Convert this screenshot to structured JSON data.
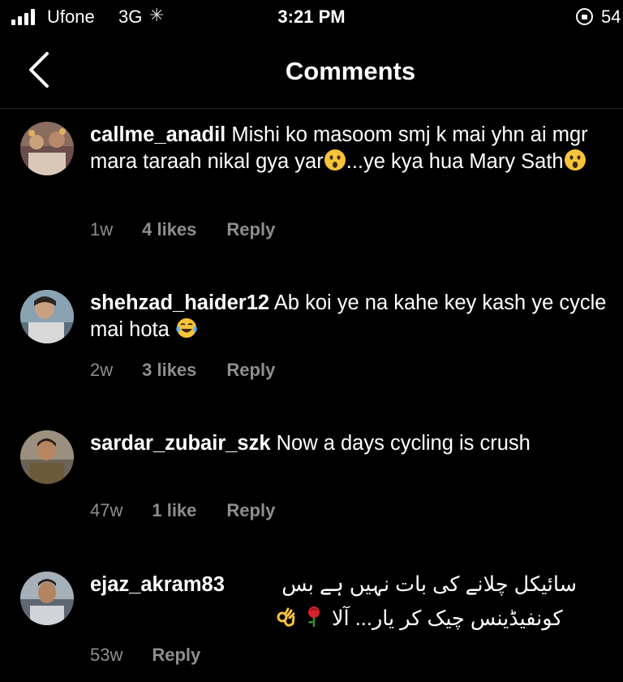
{
  "status_bar": {
    "carrier": "Ufone",
    "network": "3G",
    "time": "3:21 PM",
    "battery": "54"
  },
  "header": {
    "title": "Comments",
    "back_icon": "chevron-left-icon"
  },
  "comments": [
    {
      "username": "callme_anadil",
      "text_part1": "Mishi ko masoom smj k mai yhn ai mgr mara taraah nikal gya yar",
      "text_part2": "...ye kya hua Mary Sath",
      "time": "1w",
      "likes": "4 likes",
      "reply": "Reply"
    },
    {
      "username": "shehzad_haider12",
      "text": "Ab koi ye na kahe key kash ye cycle mai hota",
      "time": "2w",
      "likes": "3 likes",
      "reply": "Reply"
    },
    {
      "username": "sardar_zubair_szk",
      "text": "Now a days cycling is crush",
      "time": "47w",
      "likes": "1 like",
      "reply": "Reply"
    },
    {
      "username": "ejaz_akram83",
      "text_line1": "سائیکل چلانے کی بات نہیں ہے بس",
      "text_line2": "کونفیڈینس چیک کر یار... آلا",
      "time": "53w",
      "reply": "Reply"
    }
  ],
  "colors": {
    "background": "#000000",
    "text": "#ffffff",
    "secondary_text": "#8e8e8e",
    "divider": "#262626"
  }
}
